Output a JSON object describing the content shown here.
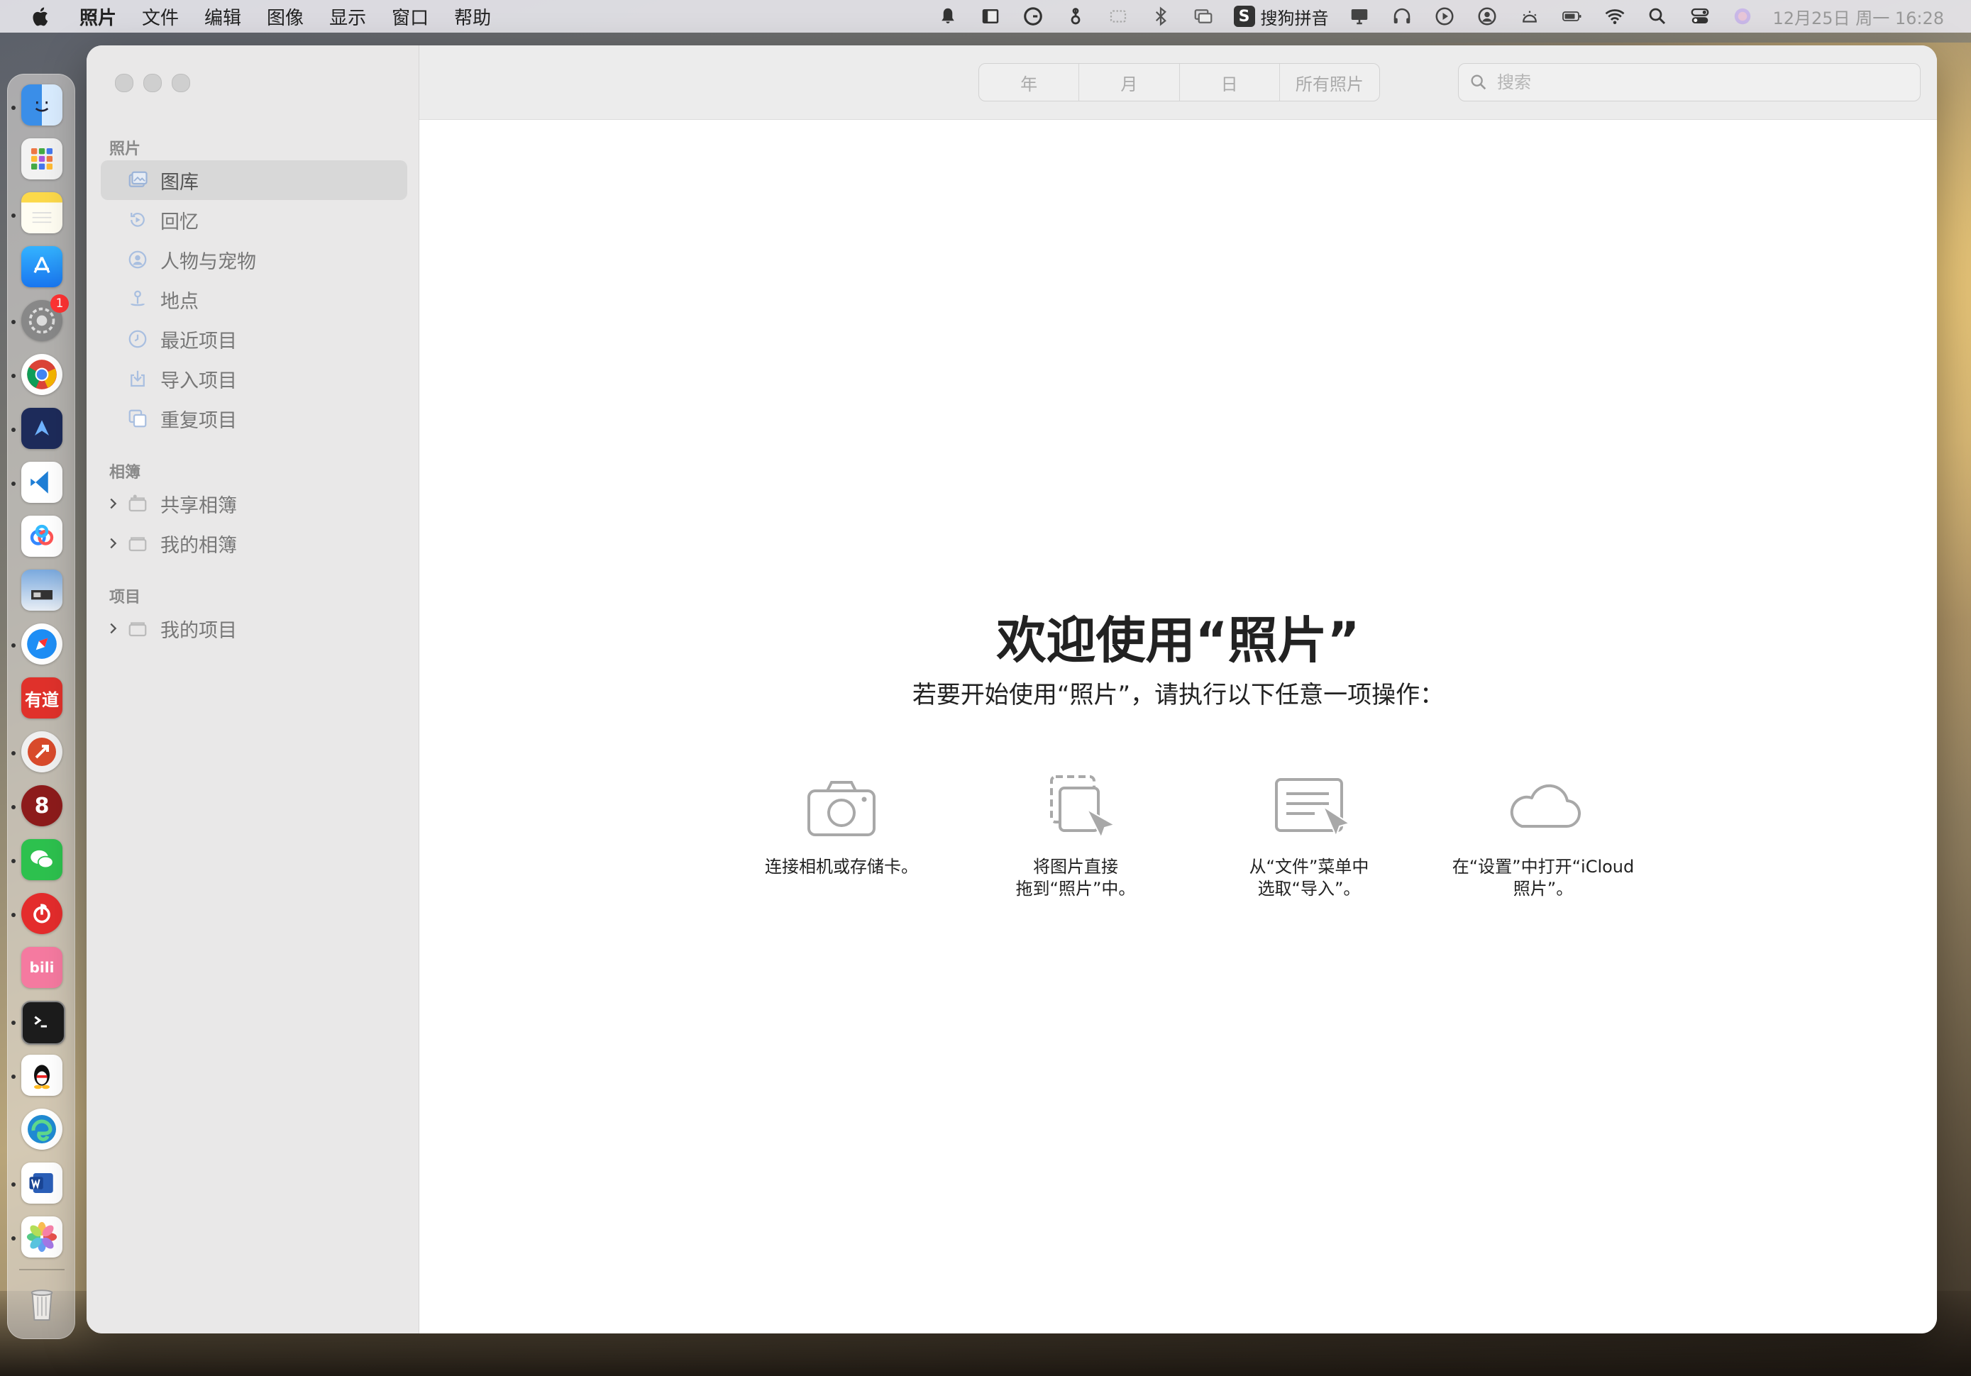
{
  "menubar": {
    "items": [
      "照片",
      "文件",
      "编辑",
      "图像",
      "显示",
      "窗口",
      "帮助"
    ],
    "ime_label": "搜狗拼音",
    "datetime": "12月25日 周一  16:28"
  },
  "dock": {
    "apps": [
      "Finder",
      "Launchpad",
      "Notes",
      "App Store",
      "System Settings",
      "Chrome",
      "App",
      "Visual Studio Code",
      "Baidu Netdisk",
      "Preview",
      "Safari",
      "Youdao Dictionary",
      "App",
      "App",
      "WeChat",
      "NetEase Music",
      "bilibili",
      "Terminal",
      "QQ",
      "Microsoft Edge",
      "Microsoft Word",
      "Photos",
      "Trash"
    ],
    "badge_count": "1"
  },
  "sidebar": {
    "section_photos": "照片",
    "items": [
      "图库",
      "回忆",
      "人物与宠物",
      "地点",
      "最近项目",
      "导入项目",
      "重复项目"
    ],
    "section_albums": "相簿",
    "albums": [
      "共享相簿",
      "我的相簿"
    ],
    "section_projects": "项目",
    "projects": [
      "我的项目"
    ]
  },
  "toolbar": {
    "segments": [
      "年",
      "月",
      "日",
      "所有照片"
    ],
    "search_placeholder": "搜索"
  },
  "welcome": {
    "title": "欢迎使用“照片”",
    "subtitle": "若要开始使用“照片”，请执行以下任意一项操作：",
    "options": [
      {
        "line1": "连接相机或存储卡。",
        "line2": ""
      },
      {
        "line1": "将图片直接",
        "line2": "拖到“照片”中。"
      },
      {
        "line1": "从“文件”菜单中",
        "line2": "选取“导入”。"
      },
      {
        "line1": "在“设置”中打开“iCloud",
        "line2": "照片”。"
      }
    ]
  },
  "colors": {
    "window_bg": "#ffffff",
    "sidebar_bg": "#e9e8e8",
    "selected_item": "#d8d8d8",
    "icon_gray": "#a8a8a8"
  }
}
